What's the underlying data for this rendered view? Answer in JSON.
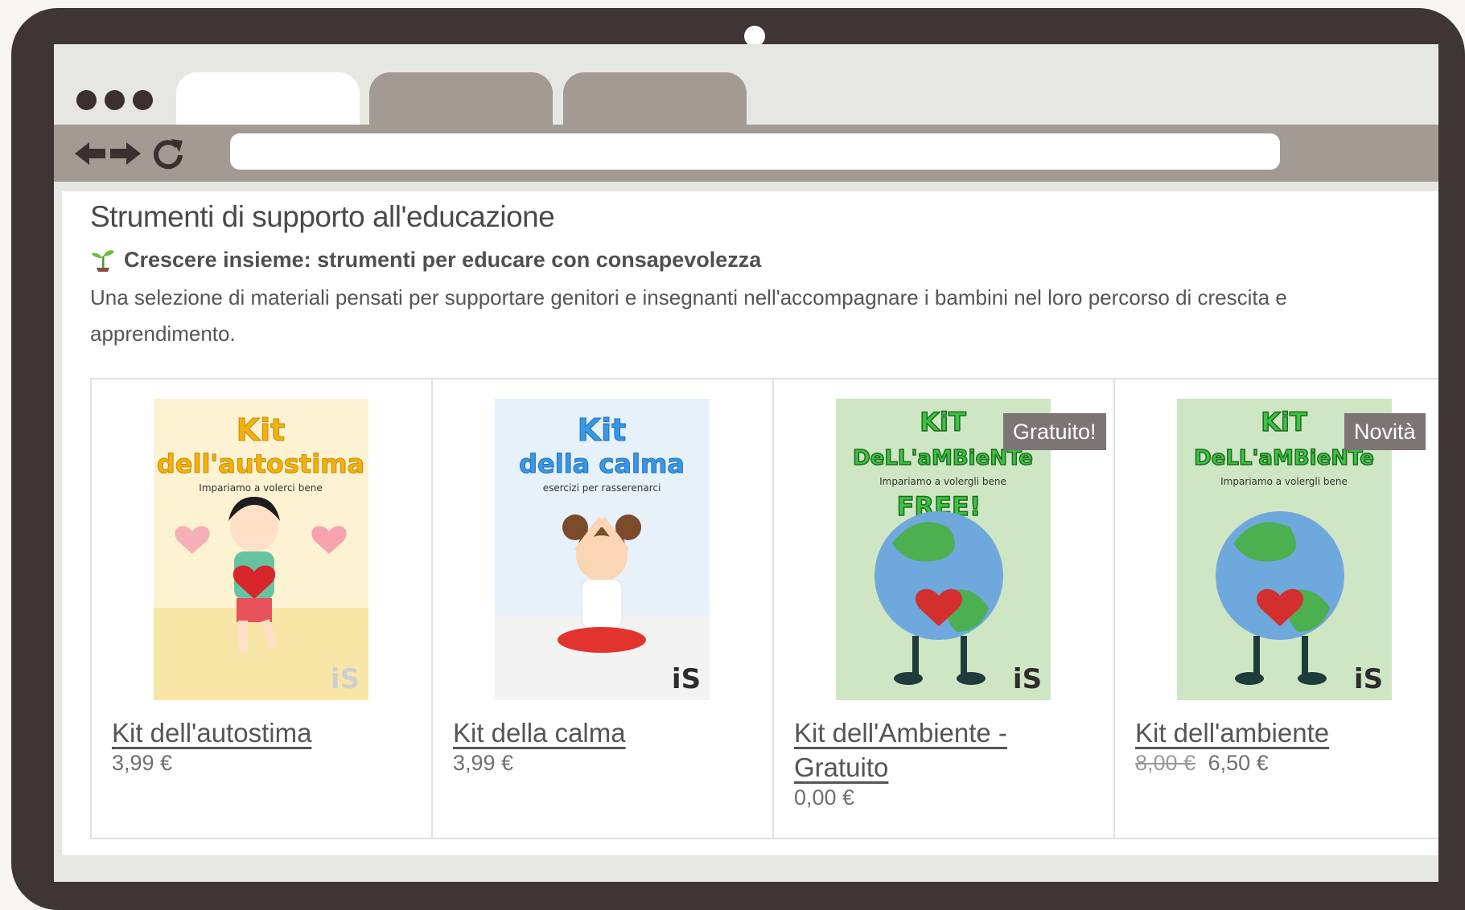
{
  "page": {
    "title": "Strumenti di supporto all'educazione",
    "subtitle": "Crescere insieme: strumenti per educare con consapevolezza",
    "description": "Una selezione di materiali pensati per supportare genitori e insegnanti nell'accompagnare i bambini nel loro percorso di crescita e apprendimento."
  },
  "products": [
    {
      "name": "Kit dell'autostima",
      "price": "3,99 €",
      "cover": {
        "line1": "Kit",
        "line2": "dell'autostima",
        "tagline": "Impariamo a volerci bene",
        "brand": "iS"
      }
    },
    {
      "name": "Kit della calma",
      "price": "3,99 €",
      "cover": {
        "line1": "Kit",
        "line2": "della calma",
        "tagline": "esercizi per rasserenarci",
        "brand": "iS"
      }
    },
    {
      "name": "Kit dell'Ambiente - Gratuito",
      "price": "0,00 €",
      "badge": "Gratuito!",
      "cover": {
        "line1": "KiT",
        "line2": "DeLL'aMBieNTe",
        "tagline": "Impariamo a volergli bene",
        "stamp": "FREE!",
        "brand": "iS"
      }
    },
    {
      "name": "Kit dell'ambiente",
      "old_price": "8,00 €",
      "price": "6,50 €",
      "badge": "Novità",
      "cover": {
        "line1": "KiT",
        "line2": "DeLL'aMBieNTe",
        "tagline": "Impariamo a volergli bene",
        "brand": "iS"
      }
    }
  ],
  "icons": [
    "back-arrow-icon",
    "forward-arrow-icon",
    "reload-icon",
    "sprout-icon"
  ],
  "colors": {
    "frame": "#3e3534",
    "tab_inactive": "#a39a93",
    "badge": "#7d7574",
    "text": "#555555"
  }
}
